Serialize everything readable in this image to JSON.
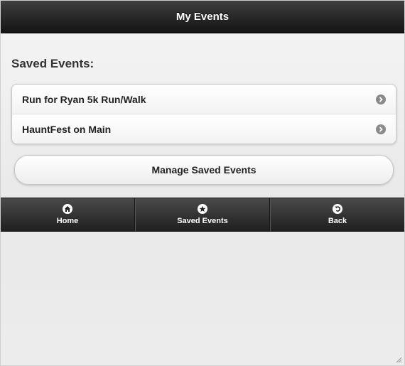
{
  "header": {
    "title": "My Events"
  },
  "saved": {
    "heading": "Saved Events:",
    "items": [
      {
        "label": "Run for Ryan 5k Run/Walk"
      },
      {
        "label": "HauntFest on Main"
      }
    ]
  },
  "manage_button": {
    "label": "Manage Saved Events"
  },
  "navbar": {
    "items": [
      {
        "label": "Home",
        "icon": "home-icon"
      },
      {
        "label": "Saved Events",
        "icon": "star-icon"
      },
      {
        "label": "Back",
        "icon": "back-icon"
      }
    ]
  }
}
